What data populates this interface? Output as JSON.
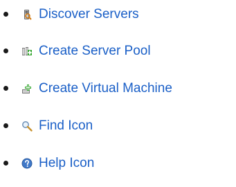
{
  "links": [
    {
      "label": "Discover Servers",
      "icon": "discover-servers-icon"
    },
    {
      "label": "Create Server Pool",
      "icon": "create-server-pool-icon"
    },
    {
      "label": "Create Virtual Machine",
      "icon": "create-virtual-machine-icon"
    },
    {
      "label": "Find Icon",
      "icon": "find-icon"
    },
    {
      "label": "Help Icon",
      "icon": "help-icon"
    }
  ],
  "colors": {
    "link": "#1a5fc7",
    "bullet": "#1a1a1a"
  }
}
